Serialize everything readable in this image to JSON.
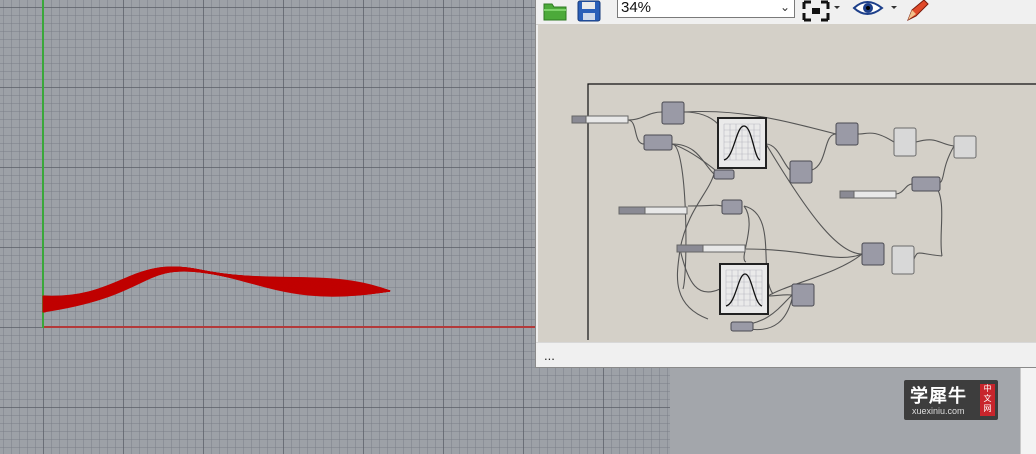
{
  "toolbar": {
    "zoom_level": "34%",
    "open_icon": "folder-open-icon",
    "save_icon": "floppy-save-icon",
    "zoom_extents_icon": "zoom-extents-icon",
    "preview_icon": "eye-icon",
    "sketch_icon": "pen-icon"
  },
  "status_bar": {
    "text": "..."
  },
  "watermark": {
    "title": "学犀牛",
    "site": "xuexiniu.com",
    "badge": "中文网"
  },
  "colors": {
    "loft_surface": "#c00000",
    "canvas_bg": "#d4d0c8",
    "component": "#9a9aa6",
    "x_axis": "#b33a3a",
    "y_axis": "#3aa83a"
  }
}
